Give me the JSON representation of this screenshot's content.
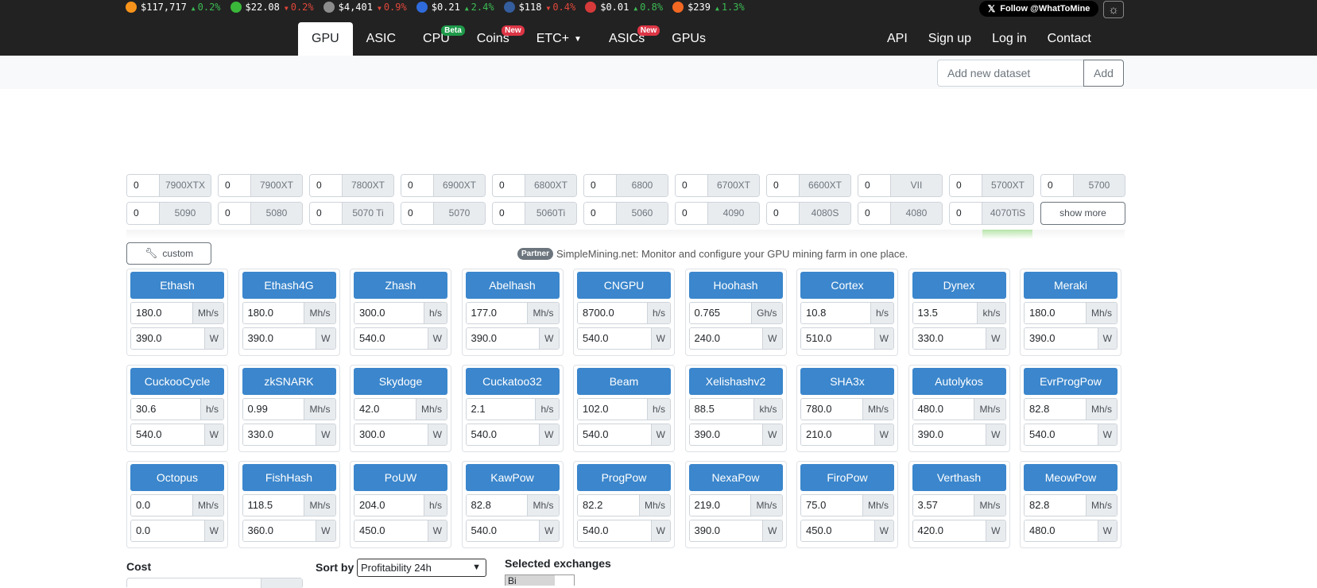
{
  "ticker": [
    {
      "price": "$117,717",
      "change": "0.2%",
      "dir": "up",
      "color": "#f7931a",
      "icon": "bitcoin-icon"
    },
    {
      "price": "$22.08",
      "change": "0.2%",
      "dir": "down",
      "color": "#3ab83a",
      "icon": "ethereum-classic-icon"
    },
    {
      "price": "$4,401",
      "change": "0.9%",
      "dir": "down",
      "color": "#8c8c8c",
      "icon": "ethereum-icon"
    },
    {
      "price": "$0.21",
      "change": "2.4%",
      "dir": "up",
      "color": "#2f6bdc",
      "icon": "ravencoin-icon"
    },
    {
      "price": "$118",
      "change": "0.4%",
      "dir": "down",
      "color": "#345d9d",
      "icon": "litecoin-icon"
    },
    {
      "price": "$0.01",
      "change": "0.8%",
      "dir": "up",
      "color": "#d63a3a",
      "icon": "flux-icon"
    },
    {
      "price": "$239",
      "change": "1.3%",
      "dir": "up",
      "color": "#f26822",
      "icon": "monero-icon"
    }
  ],
  "follow_label": "Follow @WhatToMine",
  "nav": {
    "left": [
      {
        "label": "GPU",
        "active": true
      },
      {
        "label": "ASIC"
      },
      {
        "label": "CPU",
        "badge": "Beta",
        "badge_type": "beta"
      },
      {
        "label": "Coins",
        "badge": "New",
        "badge_type": "new"
      },
      {
        "label": "ETC+",
        "caret": true
      },
      {
        "label": "ASICs",
        "badge": "New",
        "badge_type": "new"
      },
      {
        "label": "GPUs"
      }
    ],
    "right": [
      {
        "label": "API"
      },
      {
        "label": "Sign up"
      },
      {
        "label": "Log in"
      },
      {
        "label": "Contact"
      }
    ]
  },
  "dataset": {
    "placeholder": "Add new dataset",
    "add_label": "Add"
  },
  "gpus": [
    {
      "count": "0",
      "model": "7900XTX"
    },
    {
      "count": "0",
      "model": "7900XT"
    },
    {
      "count": "0",
      "model": "7800XT"
    },
    {
      "count": "0",
      "model": "6900XT"
    },
    {
      "count": "0",
      "model": "6800XT"
    },
    {
      "count": "0",
      "model": "6800"
    },
    {
      "count": "0",
      "model": "6700XT"
    },
    {
      "count": "0",
      "model": "6600XT"
    },
    {
      "count": "0",
      "model": "VII"
    },
    {
      "count": "0",
      "model": "5700XT"
    },
    {
      "count": "0",
      "model": "5700"
    },
    {
      "count": "0",
      "model": "5090"
    },
    {
      "count": "0",
      "model": "5080"
    },
    {
      "count": "0",
      "model": "5070 Ti"
    },
    {
      "count": "0",
      "model": "5070"
    },
    {
      "count": "0",
      "model": "5060Ti"
    },
    {
      "count": "0",
      "model": "5060"
    },
    {
      "count": "0",
      "model": "4090"
    },
    {
      "count": "0",
      "model": "4080S"
    },
    {
      "count": "0",
      "model": "4080"
    },
    {
      "count": "0",
      "model": "4070TiS"
    }
  ],
  "show_more_label": "show more",
  "custom_label": "custom",
  "partner": {
    "tag": "Partner",
    "text": "SimpleMining.net: Monitor and configure your GPU mining farm in one place."
  },
  "algorithms": [
    {
      "name": "Ethash",
      "hashrate": "180.0",
      "hash_unit": "Mh/s",
      "power": "390.0",
      "power_unit": "W"
    },
    {
      "name": "Ethash4G",
      "hashrate": "180.0",
      "hash_unit": "Mh/s",
      "power": "390.0",
      "power_unit": "W"
    },
    {
      "name": "Zhash",
      "hashrate": "300.0",
      "hash_unit": "h/s",
      "power": "540.0",
      "power_unit": "W"
    },
    {
      "name": "Abelhash",
      "hashrate": "177.0",
      "hash_unit": "Mh/s",
      "power": "390.0",
      "power_unit": "W"
    },
    {
      "name": "CNGPU",
      "hashrate": "8700.0",
      "hash_unit": "h/s",
      "power": "540.0",
      "power_unit": "W"
    },
    {
      "name": "Hoohash",
      "hashrate": "0.765",
      "hash_unit": "Gh/s",
      "power": "240.0",
      "power_unit": "W"
    },
    {
      "name": "Cortex",
      "hashrate": "10.8",
      "hash_unit": "h/s",
      "power": "510.0",
      "power_unit": "W"
    },
    {
      "name": "Dynex",
      "hashrate": "13.5",
      "hash_unit": "kh/s",
      "power": "330.0",
      "power_unit": "W"
    },
    {
      "name": "Meraki",
      "hashrate": "180.0",
      "hash_unit": "Mh/s",
      "power": "390.0",
      "power_unit": "W"
    },
    {
      "name": "CuckooCycle",
      "hashrate": "30.6",
      "hash_unit": "h/s",
      "power": "540.0",
      "power_unit": "W"
    },
    {
      "name": "zkSNARK",
      "hashrate": "0.99",
      "hash_unit": "Mh/s",
      "power": "330.0",
      "power_unit": "W"
    },
    {
      "name": "Skydoge",
      "hashrate": "42.0",
      "hash_unit": "Mh/s",
      "power": "300.0",
      "power_unit": "W"
    },
    {
      "name": "Cuckatoo32",
      "hashrate": "2.1",
      "hash_unit": "h/s",
      "power": "540.0",
      "power_unit": "W"
    },
    {
      "name": "Beam",
      "hashrate": "102.0",
      "hash_unit": "h/s",
      "power": "540.0",
      "power_unit": "W"
    },
    {
      "name": "Xelishashv2",
      "hashrate": "88.5",
      "hash_unit": "kh/s",
      "power": "390.0",
      "power_unit": "W"
    },
    {
      "name": "SHA3x",
      "hashrate": "780.0",
      "hash_unit": "Mh/s",
      "power": "210.0",
      "power_unit": "W"
    },
    {
      "name": "Autolykos",
      "hashrate": "480.0",
      "hash_unit": "Mh/s",
      "power": "390.0",
      "power_unit": "W"
    },
    {
      "name": "EvrProgPow",
      "hashrate": "82.8",
      "hash_unit": "Mh/s",
      "power": "540.0",
      "power_unit": "W"
    },
    {
      "name": "Octopus",
      "hashrate": "0.0",
      "hash_unit": "Mh/s",
      "power": "0.0",
      "power_unit": "W"
    },
    {
      "name": "FishHash",
      "hashrate": "118.5",
      "hash_unit": "Mh/s",
      "power": "360.0",
      "power_unit": "W"
    },
    {
      "name": "PoUW",
      "hashrate": "204.0",
      "hash_unit": "h/s",
      "power": "450.0",
      "power_unit": "W"
    },
    {
      "name": "KawPow",
      "hashrate": "82.8",
      "hash_unit": "Mh/s",
      "power": "540.0",
      "power_unit": "W"
    },
    {
      "name": "ProgPow",
      "hashrate": "82.2",
      "hash_unit": "Mh/s",
      "power": "540.0",
      "power_unit": "W"
    },
    {
      "name": "NexaPow",
      "hashrate": "219.0",
      "hash_unit": "Mh/s",
      "power": "390.0",
      "power_unit": "W"
    },
    {
      "name": "FiroPow",
      "hashrate": "75.0",
      "hash_unit": "Mh/s",
      "power": "450.0",
      "power_unit": "W"
    },
    {
      "name": "Verthash",
      "hashrate": "3.57",
      "hash_unit": "Mh/s",
      "power": "420.0",
      "power_unit": "W"
    },
    {
      "name": "MeowPow",
      "hashrate": "82.8",
      "hash_unit": "Mh/s",
      "power": "480.0",
      "power_unit": "W"
    }
  ],
  "form": {
    "cost_label": "Cost",
    "sort_label": "Sort by",
    "sort_value": "Profitability 24h",
    "exchanges_label": "Selected exchanges",
    "exchange_first": "Bi"
  }
}
